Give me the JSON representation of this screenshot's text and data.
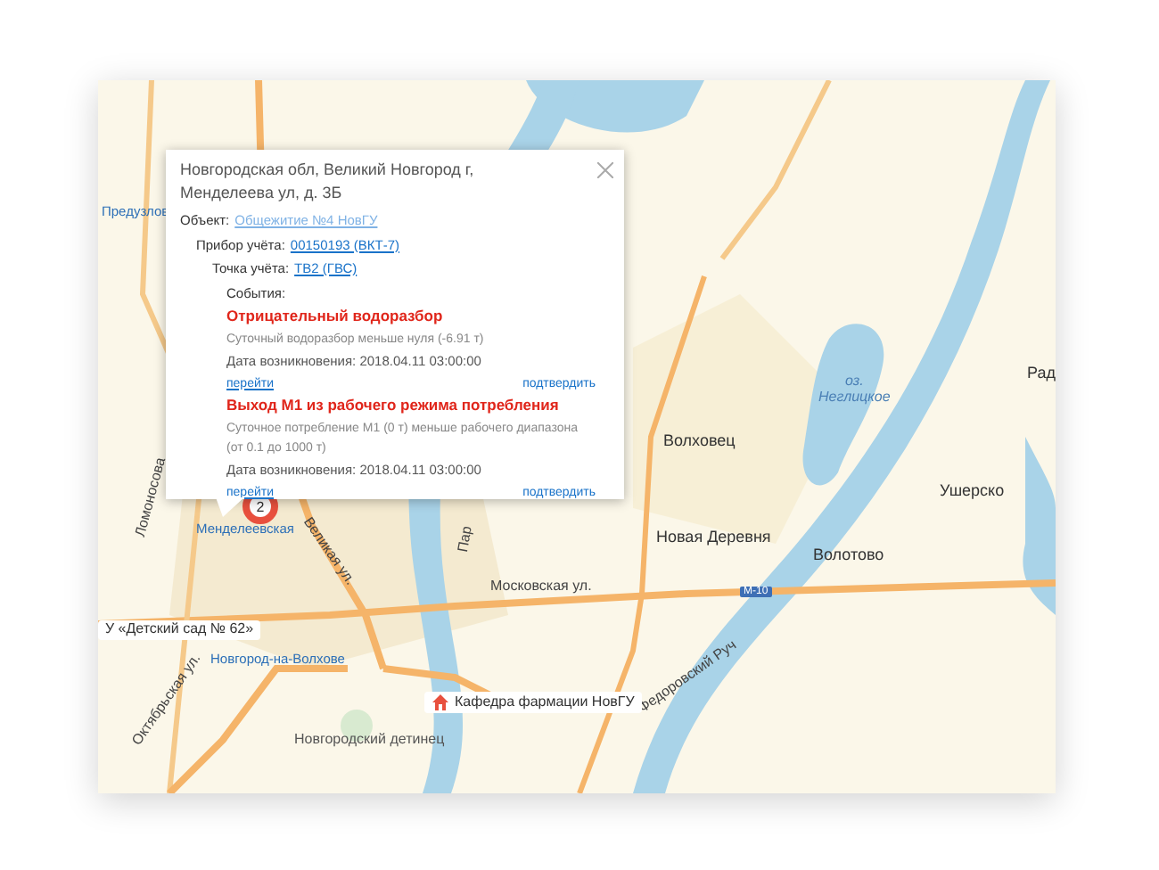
{
  "popup": {
    "address": "Новгородская обл, Великий Новгород г, Менделеева ул, д. 3Б",
    "fields": [
      {
        "label": "Объект:",
        "value": "Общежитие №4 НовГУ",
        "blurred": true
      },
      {
        "label": "Прибор учёта:",
        "value": "00150193 (ВКТ-7)",
        "blurred": false
      },
      {
        "label": "Точка учёта:",
        "value": "ТВ2 (ГВС)",
        "blurred": false
      }
    ],
    "events_label": "События:",
    "events": [
      {
        "title": "Отрицательный водоразбор",
        "description": "Суточный водоразбор меньше нуля (-6.91 т)",
        "date_label": "Дата возникновения:",
        "date": "2018.04.11 03:00:00",
        "go_link": "перейти",
        "confirm_link": "подтвердить"
      },
      {
        "title": "Выход М1 из рабочего режима потребления",
        "description": "Суточное потребление М1 (0 т) меньше рабочего диапазона (от 0.1 до 1000 т)",
        "date_label": "Дата возникновения:",
        "date": "2018.04.11 03:00:00",
        "go_link": "перейти",
        "confirm_link": "подтвердить"
      }
    ]
  },
  "map": {
    "cluster": "2",
    "highway": "М-10",
    "labels": [
      {
        "text": "Предузлов",
        "kind": "metro"
      },
      {
        "text": "Волховец",
        "kind": "place"
      },
      {
        "text": "Новая Деревня",
        "kind": "place"
      },
      {
        "text": "Волотово",
        "kind": "place"
      },
      {
        "text": "Ушерско",
        "kind": "place"
      },
      {
        "text": "Рад",
        "kind": "place"
      },
      {
        "text": "оз.\nНеглицкое",
        "kind": "water"
      },
      {
        "text": "Менделеевская",
        "kind": "metro"
      },
      {
        "text": "Великая ул.",
        "kind": "street"
      },
      {
        "text": "Московская ул.",
        "kind": "street"
      },
      {
        "text": "Ломоносова",
        "kind": "street"
      },
      {
        "text": "Федоровский Руч",
        "kind": "street"
      },
      {
        "text": "Октябрьская ул.",
        "kind": "street"
      },
      {
        "text": "Новгород-на-Волхове",
        "kind": "metro"
      },
      {
        "text": "Новгородский детинец",
        "kind": "landmark"
      },
      {
        "text": "У «Детский сад № 62»",
        "kind": "poi"
      },
      {
        "text": "Кафедра фармации НовГУ",
        "kind": "poi_icon"
      },
      {
        "text": "Пар",
        "kind": "street"
      }
    ]
  }
}
